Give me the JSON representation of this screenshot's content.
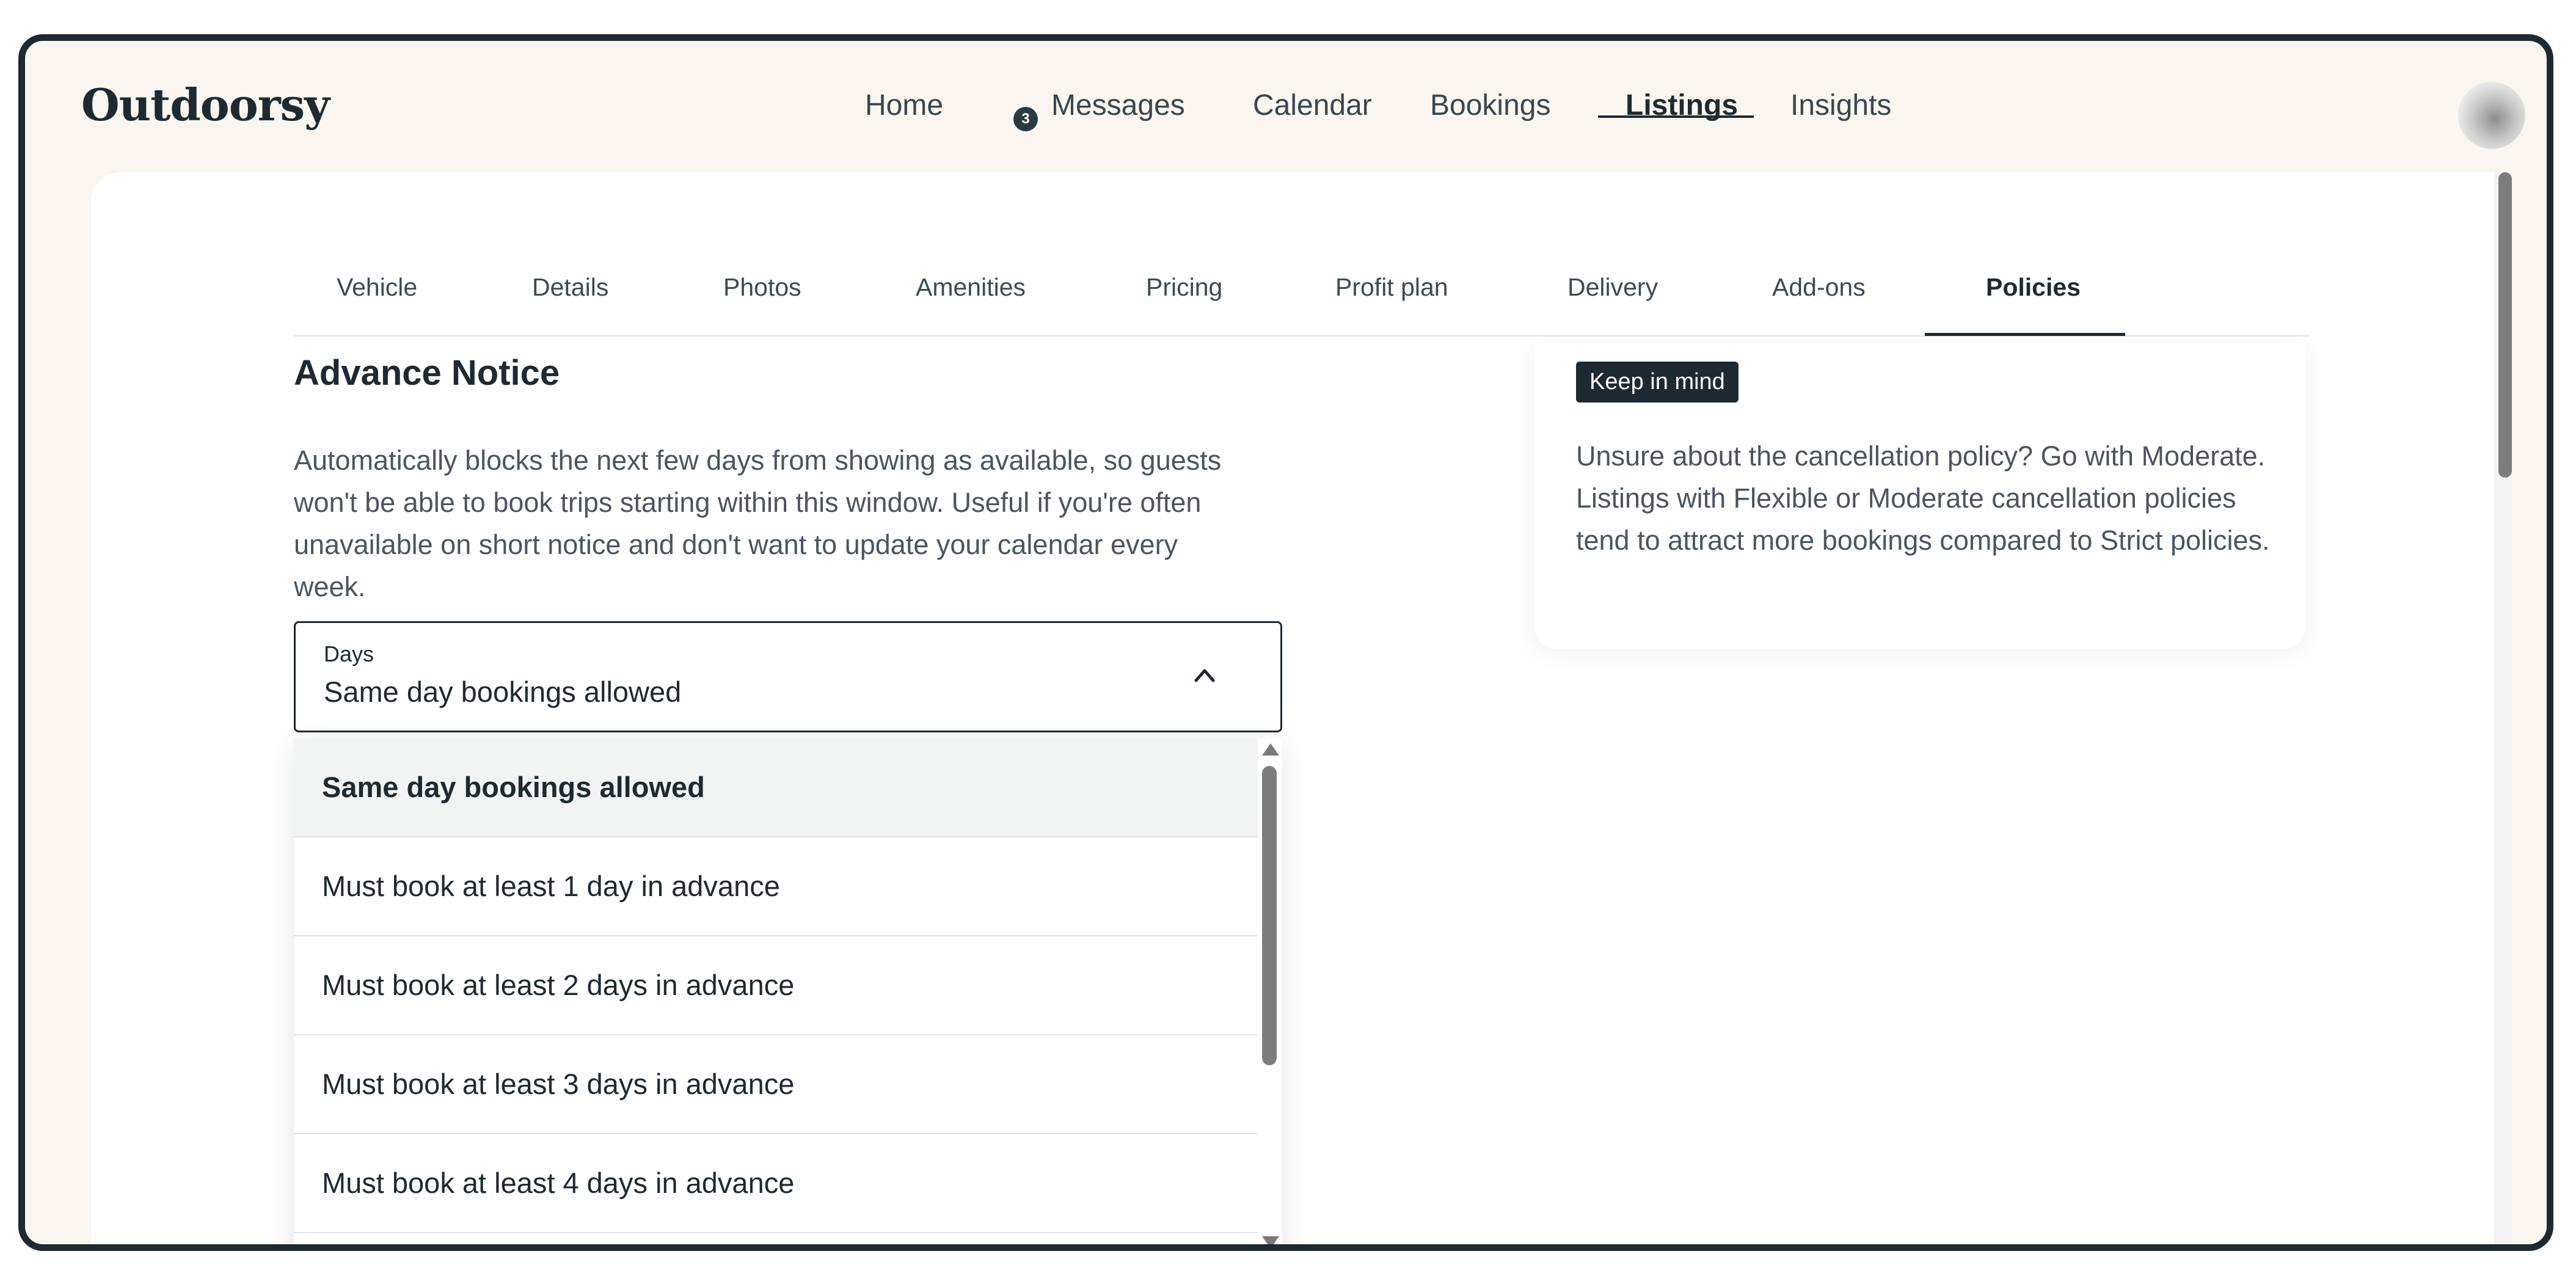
{
  "app": {
    "logo": "Outdoorsy"
  },
  "nav": {
    "items": [
      {
        "label": "Home"
      },
      {
        "label": "Messages",
        "badge": "3"
      },
      {
        "label": "Calendar"
      },
      {
        "label": "Bookings"
      },
      {
        "label": "Listings",
        "active": true
      },
      {
        "label": "Insights"
      }
    ]
  },
  "tabs": [
    {
      "label": "Vehicle"
    },
    {
      "label": "Details"
    },
    {
      "label": "Photos"
    },
    {
      "label": "Amenities"
    },
    {
      "label": "Pricing"
    },
    {
      "label": "Profit plan"
    },
    {
      "label": "Delivery"
    },
    {
      "label": "Add-ons"
    },
    {
      "label": "Policies",
      "active": true
    }
  ],
  "advance_notice": {
    "title": "Advance Notice",
    "description": "Automatically blocks the next few days from showing as available, so guests won't be able to book trips starting within this window. Useful if you're often unavailable on short notice and don't want to update your calendar every week.",
    "select": {
      "label": "Days",
      "value": "Same day bookings allowed",
      "expanded": true
    },
    "options": [
      {
        "label": "Same day bookings allowed",
        "selected": true
      },
      {
        "label": "Must book at least 1 day in advance"
      },
      {
        "label": "Must book at least 2 days in advance"
      },
      {
        "label": "Must book at least 3 days in advance"
      },
      {
        "label": "Must book at least 4 days in advance"
      }
    ]
  },
  "keep_in_mind": {
    "badge": "Keep in mind",
    "text": "Unsure about the cancellation policy? Go with Moderate. Listings with Flexible or Moderate cancellation policies tend to attract more bookings compared to Strict policies."
  },
  "icons": {
    "chevron": "chevron-up-icon",
    "avatar": "user-avatar"
  },
  "colors": {
    "primary_dark": "#1e2a31",
    "page_bg": "#f8f6ee",
    "selected_option_bg": "#f2f3f3"
  }
}
